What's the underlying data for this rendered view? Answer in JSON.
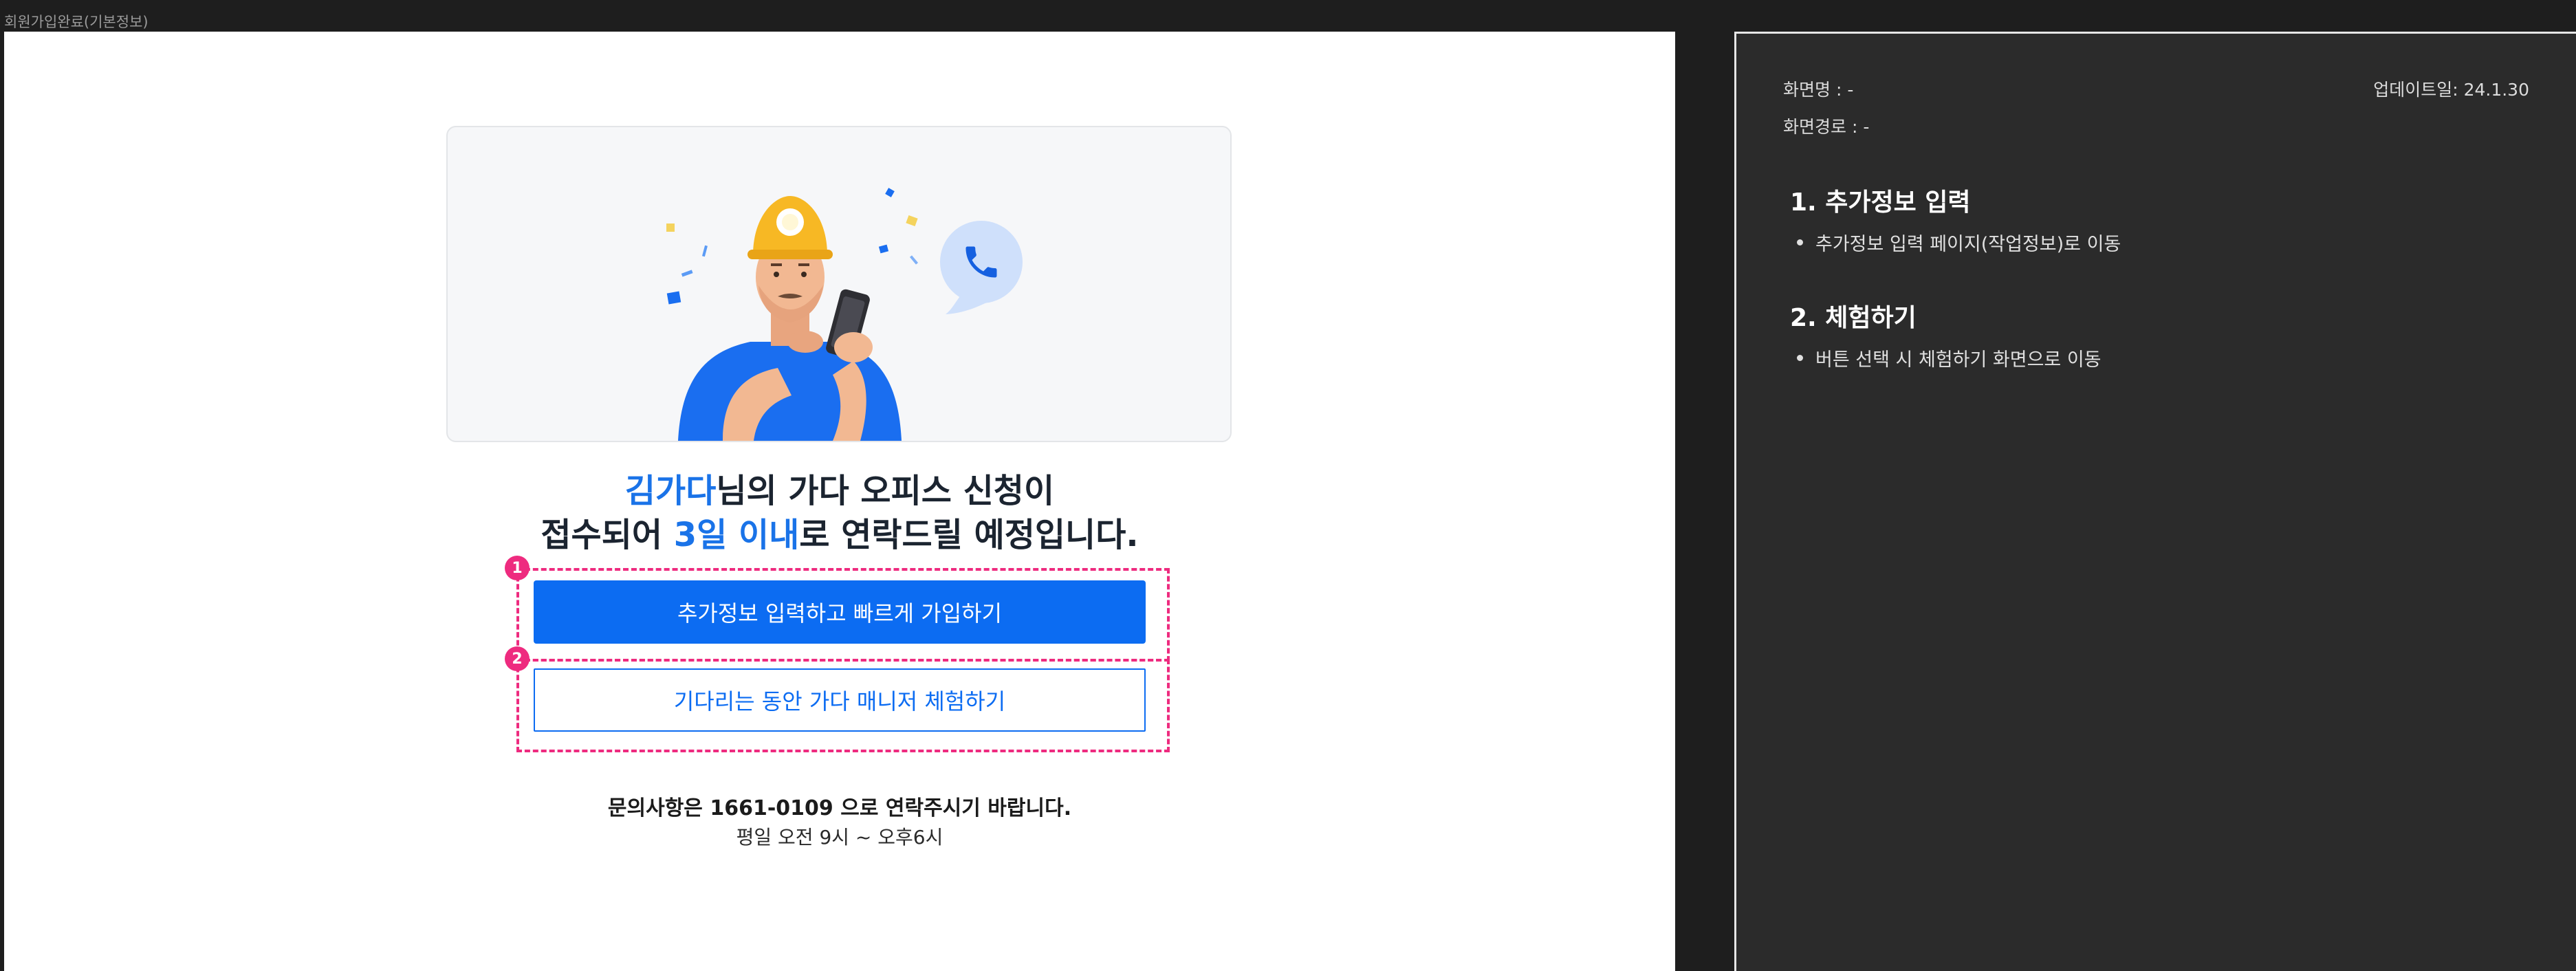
{
  "frame": {
    "label": "회원가입완료(기본정보)"
  },
  "illustration": {
    "phone_icon": "phone-icon",
    "worker": "worker-illustration"
  },
  "headline": {
    "name": "김가다",
    "line1_rest": "님의 가다 오피스 신청이",
    "line2_prefix": "접수되어 ",
    "line2_highlight": "3일 이내",
    "line2_rest": "로 연락드릴 예정입니다."
  },
  "buttons": {
    "primary": "추가정보 입력하고 빠르게 가입하기",
    "secondary": "기다리는 동안 가다 매니저 체험하기"
  },
  "annotations": {
    "badge1": "1",
    "badge2": "2"
  },
  "contact": {
    "line": "문의사항은 1661-0109 으로 연락주시기 바랍니다.",
    "hours": "평일 오전 9시 ~ 오후6시"
  },
  "notes": {
    "screen_name": "화면명 : -",
    "updated": "업데이트일: 24.1.30",
    "screen_path": "화면경로 : -",
    "sections": [
      {
        "title": "1. 추가정보 입력",
        "bullet": "추가정보 입력 페이지(작업정보)로 이동"
      },
      {
        "title": "2. 체험하기",
        "bullet": "버튼 선택 시 체험하기 화면으로 이동"
      }
    ]
  },
  "colors": {
    "accent": "#0c6cf2",
    "highlight": "#1a73e8",
    "annotation": "#ee2b7f",
    "panel": "#2b2b2b"
  }
}
